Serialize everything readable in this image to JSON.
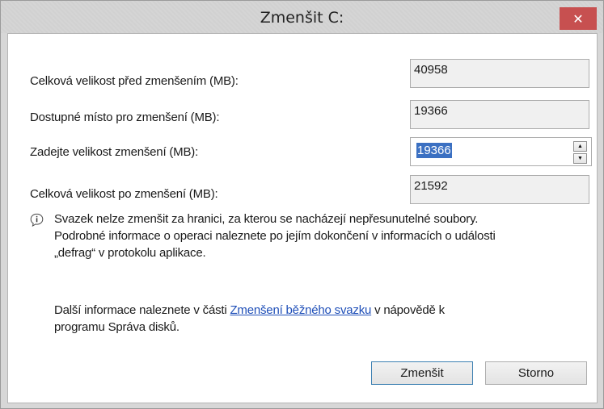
{
  "dialog": {
    "title": "Zmenšit C:",
    "close_glyph": "✕"
  },
  "fields": [
    {
      "label": "Celková velikost před zmenšením (MB):",
      "value": "40958"
    },
    {
      "label": "Dostupné místo pro zmenšení (MB):",
      "value": "19366"
    },
    {
      "label": "Zadejte velikost zmenšení (MB):",
      "value": "19366"
    },
    {
      "label": "Celková velikost po zmenšení (MB):",
      "value": "21592"
    }
  ],
  "spinner": {
    "up": "▲",
    "down": "▼"
  },
  "info": {
    "icon": "info-icon",
    "line1": "Svazek nelze zmenšit za hranici, za kterou se nacházejí nepřesunutelné soubory.",
    "line2": "Podrobné informace o operaci naleznete po jejím dokončení v informacích o události",
    "line3": "„defrag“ v protokolu aplikace."
  },
  "help": {
    "before": "Další informace naleznete v části ",
    "link": "Zmenšení běžného svazku",
    "after": " v nápovědě k",
    "line2": "programu Správa disků."
  },
  "buttons": {
    "shrink": "Zmenšit",
    "cancel": "Storno"
  }
}
